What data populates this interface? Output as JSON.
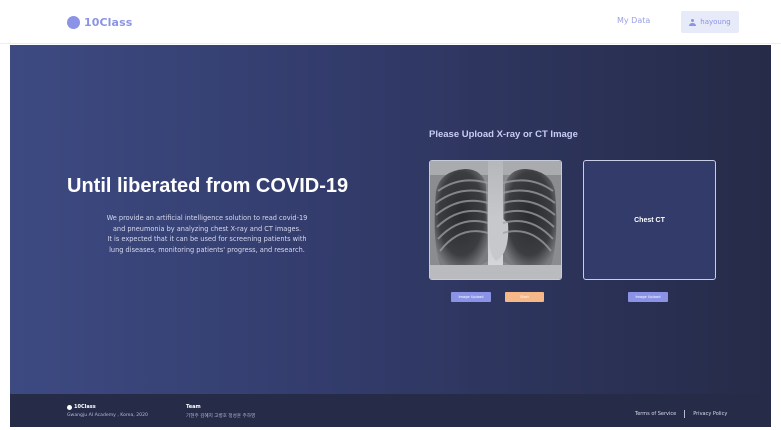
{
  "header": {
    "brand": "10Class",
    "nav_mydata": "My Data",
    "user_name": "hayoung",
    "colors": {
      "accent": "#8b93e6",
      "accent_light": "#e7eaf8"
    }
  },
  "hero": {
    "title": "Until liberated from COVID-19",
    "description": [
      "We provide an artificial intelligence solution to read covid-19",
      "and pneumonia by analyzing chest X-ray and CT images.",
      "It is expected that it can be used for screening patients with",
      "lung diseases, monitoring patients' progress, and research."
    ],
    "upload_heading": "Please Upload X-ray or CT Image",
    "ct_label": "Chest CT",
    "buttons": {
      "upload_xray": "Image Upload",
      "start": "Start",
      "upload_ct": "Image Upload"
    },
    "colors": {
      "gradient_start": "#3d4a82",
      "gradient_end": "#262b48",
      "start_button": "#f6b889"
    }
  },
  "footer": {
    "brand": "10Class",
    "subtitle": "Gwangju AI Academy , Korea, 2020",
    "team_heading": "Team",
    "team_members": "기현주  김혜지  고병호  정성훈  주하영",
    "links": [
      "Terms of Service",
      "Privacy Policy"
    ]
  }
}
